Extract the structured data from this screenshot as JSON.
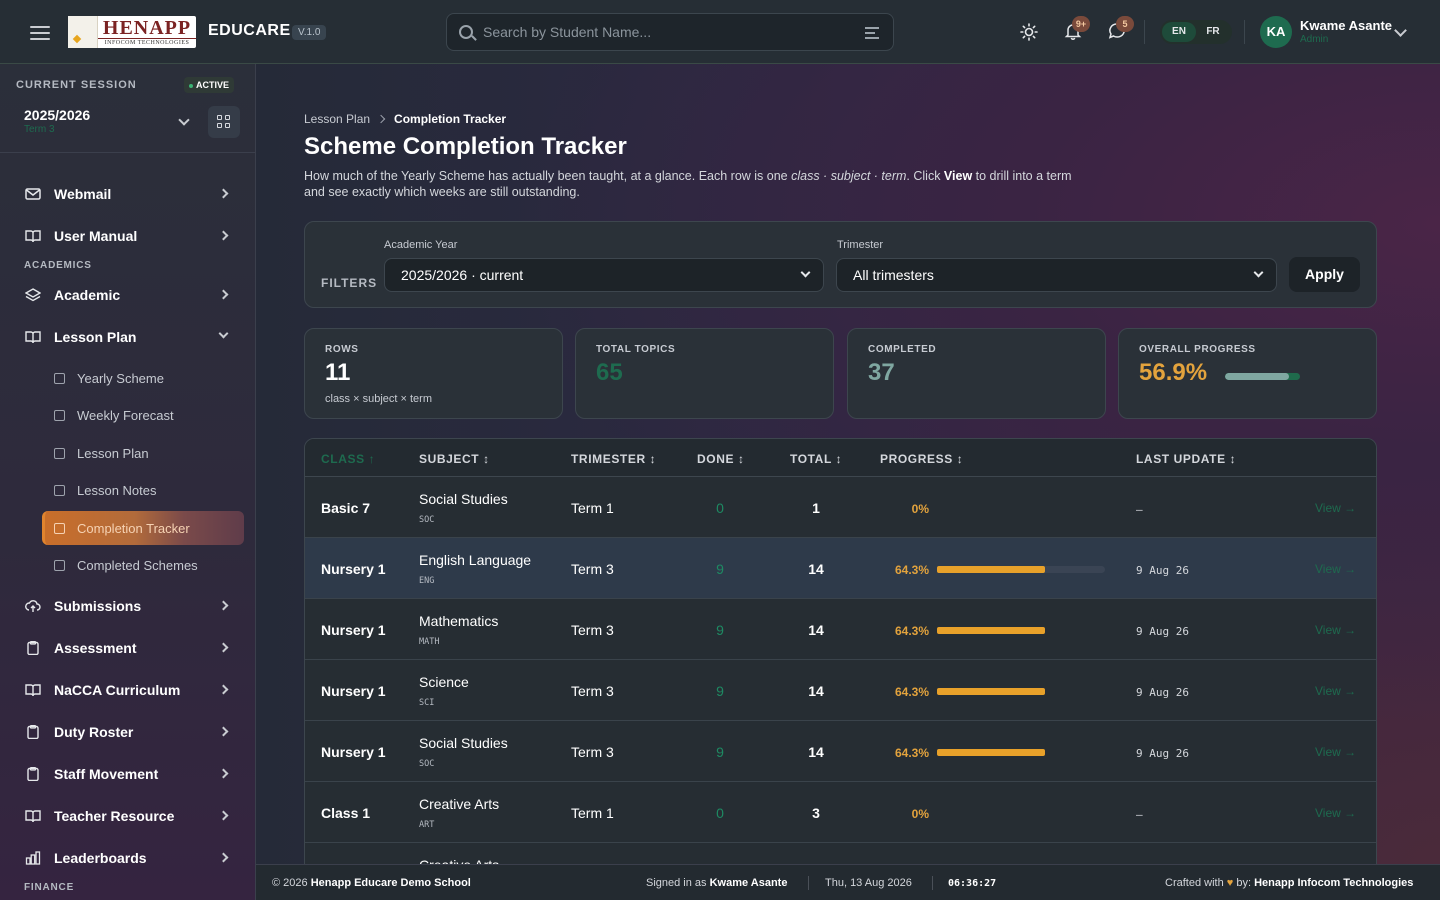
{
  "header": {
    "logo_text": "HENAPP",
    "logo_subtext": "INFOCOM TECHNOLOGIES",
    "brand": "EDUCARE",
    "version": "V.1.0",
    "search_placeholder": "Search by Student Name...",
    "notifications_badge": "9+",
    "messages_badge": "5",
    "languages": [
      "EN",
      "FR"
    ],
    "user_initials": "KA",
    "user_name": "Kwame Asante",
    "user_role": "Admin"
  },
  "sidebar": {
    "session_label": "CURRENT SESSION",
    "session_status": "ACTIVE",
    "session_year": "2025/2026",
    "session_term": "Term 3",
    "items_top": [
      {
        "label": "Webmail"
      },
      {
        "label": "User Manual"
      }
    ],
    "section_academics": "ACADEMICS",
    "academic_item": "Academic",
    "lesson_plan_item": "Lesson Plan",
    "lesson_plan_children": [
      {
        "label": "Yearly Scheme"
      },
      {
        "label": "Weekly Forecast"
      },
      {
        "label": "Lesson Plan"
      },
      {
        "label": "Lesson Notes"
      },
      {
        "label": "Completion Tracker"
      },
      {
        "label": "Completed Schemes"
      }
    ],
    "items_bottom": [
      {
        "label": "Submissions"
      },
      {
        "label": "Assessment"
      },
      {
        "label": "NaCCA Curriculum"
      },
      {
        "label": "Duty Roster"
      },
      {
        "label": "Staff Movement"
      },
      {
        "label": "Teacher Resource"
      },
      {
        "label": "Leaderboards"
      }
    ],
    "section_finance": "FINANCE"
  },
  "main": {
    "breadcrumb": [
      "Lesson Plan",
      "Completion Tracker"
    ],
    "title": "Scheme Completion Tracker",
    "desc_1": "How much of the Yearly Scheme has actually been taught, at a glance. Each row is one ",
    "desc_em": "class · subject · term",
    "desc_2": ". Click ",
    "desc_b": "View",
    "desc_3": " to drill into a term and see exactly which weeks are still outstanding.",
    "filters": {
      "label": "FILTERS",
      "year_label": "Academic Year",
      "year_value": "2025/2026 · current",
      "trimester_label": "Trimester",
      "trimester_value": "All trimesters",
      "apply": "Apply"
    },
    "stats": {
      "rows_label": "ROWS",
      "rows_value": "11",
      "rows_sub": "class × subject × term",
      "topics_label": "TOTAL TOPICS",
      "topics_value": "65",
      "completed_label": "COMPLETED",
      "completed_value": "37",
      "progress_label": "OVERALL PROGRESS",
      "progress_value": "56.9%",
      "progress_fraction": 0.857,
      "colors": {
        "topics": "#1e6b4f",
        "completed": "#7fa7a1",
        "progress": "#e3a33d"
      }
    },
    "table": {
      "headers": [
        "CLASS ↑",
        "SUBJECT ↕",
        "TRIMESTER ↕",
        "DONE ↕",
        "TOTAL ↕",
        "PROGRESS ↕",
        "LAST UPDATE ↕"
      ],
      "view_label": "View →",
      "rows": [
        {
          "class": "Basic 7",
          "subject": "Social Studies",
          "code": "SOC",
          "term": "Term 1",
          "done": "0",
          "total": "1",
          "pct": "0%",
          "fill": 0,
          "date": "–"
        },
        {
          "class": "Nursery 1",
          "subject": "English Language",
          "code": "ENG",
          "term": "Term 3",
          "done": "9",
          "total": "14",
          "pct": "64.3%",
          "fill": 0.643,
          "date": "9 Aug 26"
        },
        {
          "class": "Nursery 1",
          "subject": "Mathematics",
          "code": "MATH",
          "term": "Term 3",
          "done": "9",
          "total": "14",
          "pct": "64.3%",
          "fill": 0.643,
          "date": "9 Aug 26"
        },
        {
          "class": "Nursery 1",
          "subject": "Science",
          "code": "SCI",
          "term": "Term 3",
          "done": "9",
          "total": "14",
          "pct": "64.3%",
          "fill": 0.643,
          "date": "9 Aug 26"
        },
        {
          "class": "Nursery 1",
          "subject": "Social Studies",
          "code": "SOC",
          "term": "Term 3",
          "done": "9",
          "total": "14",
          "pct": "64.3%",
          "fill": 0.643,
          "date": "9 Aug 26"
        },
        {
          "class": "Class 1",
          "subject": "Creative Arts",
          "code": "ART",
          "term": "Term 1",
          "done": "0",
          "total": "3",
          "pct": "0%",
          "fill": 0,
          "date": "–"
        },
        {
          "class": "",
          "subject": "Creative Arts",
          "code": "",
          "term": "",
          "done": "",
          "total": "",
          "pct": "",
          "fill": 0,
          "date": ""
        }
      ]
    }
  },
  "footer": {
    "copyright_prefix": "© 2026 ",
    "school": "Henapp Educare Demo School",
    "signed_prefix": "Signed in as ",
    "signed_user": "Kwame Asante",
    "date": "Thu, 13 Aug 2026",
    "time": "06:36:27",
    "crafted_prefix": "Crafted with ",
    "crafted_mid": " by: ",
    "crafted_company": "Henapp Infocom Technologies"
  }
}
